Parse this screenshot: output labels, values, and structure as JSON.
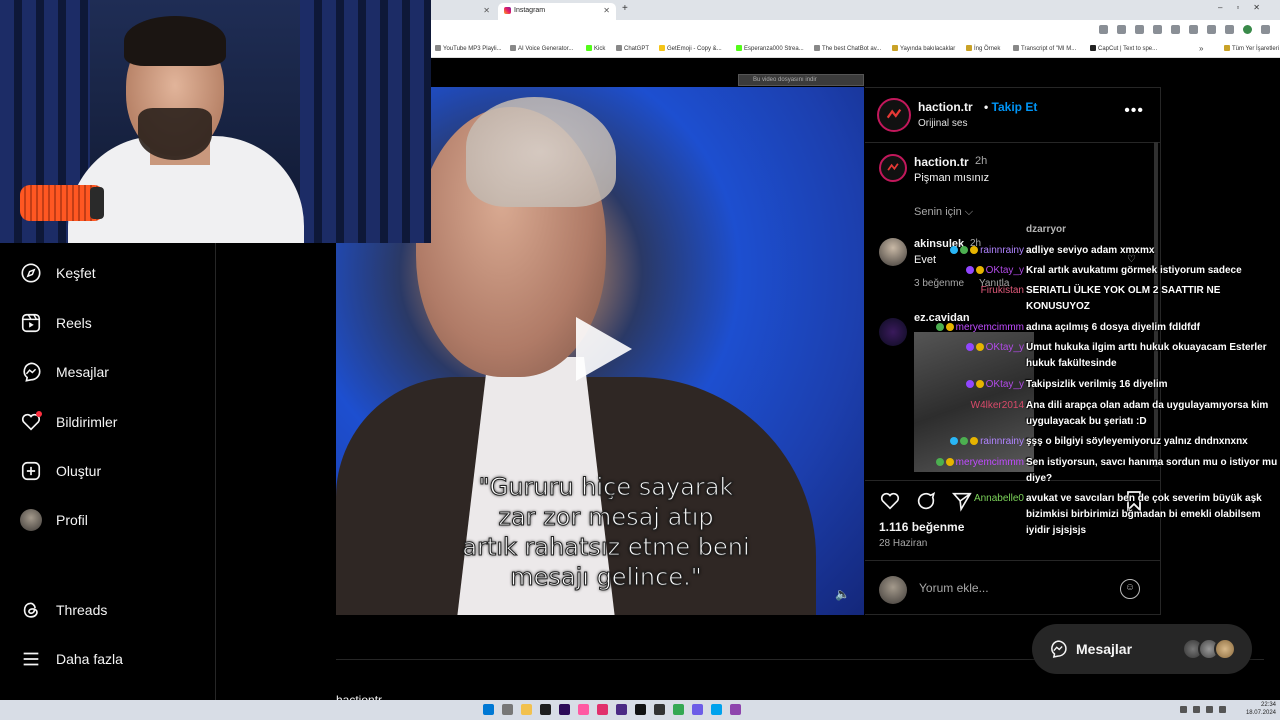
{
  "browser": {
    "tabs": [
      {
        "title": ""
      },
      {
        "title": "Instagram"
      }
    ],
    "bookmarks": [
      "YouTube MP3 Playli...",
      "AI Voice Generator...",
      "Kick",
      "ChatGPT",
      "GetEmoji - Copy &...",
      "Esperanza000 Strea...",
      "The best ChatBot av...",
      "Yayında bakılacaklar",
      "İng Örnek",
      "Transcript of \"MI M...",
      "CapCut | Text to spe..."
    ],
    "bookmarks_other": "Tüm Yer İşaretleri",
    "download_notice": "Bu video dosyasını indir"
  },
  "sidebar": {
    "items": [
      {
        "label": "Keşfet",
        "icon": "compass-icon"
      },
      {
        "label": "Reels",
        "icon": "reels-icon"
      },
      {
        "label": "Mesajlar",
        "icon": "messenger-icon"
      },
      {
        "label": "Bildirimler",
        "icon": "heart-icon"
      },
      {
        "label": "Oluştur",
        "icon": "plus-square-icon"
      },
      {
        "label": "Profil",
        "icon": "avatar"
      },
      {
        "label": "Threads",
        "icon": "threads-icon"
      },
      {
        "label": "Daha fazla",
        "icon": "menu-icon"
      }
    ]
  },
  "video": {
    "subtitle_lines": [
      "\"Gururu hiçe sayarak",
      "zar zor mesaj atıp",
      "artık rahatsız etme beni",
      "mesajı gelince.\""
    ]
  },
  "post": {
    "username": "haction.tr",
    "separator": "•",
    "follow_label": "Takip Et",
    "audio": "Orijinal ses",
    "caption_user": "haction.tr",
    "caption_time": "2h",
    "caption_text": "Pişman mısınız",
    "for_you": "Senin için",
    "comments": [
      {
        "user": "akinsulek",
        "time": "2h",
        "text": "Evet",
        "likes": "3 beğenme",
        "reply": "Yanıtla"
      },
      {
        "user": "ez.cavidan"
      }
    ],
    "likes": "1.116 beğenme",
    "date": "28 Haziran",
    "comment_placeholder": "Yorum ekle..."
  },
  "chat": [
    {
      "user": "",
      "text": "dzarryor",
      "color": "#ffffff"
    },
    {
      "user": "rainnrainy",
      "text": "adliye seviyo adam xmxmx",
      "color": "#b084ff",
      "badges": [
        "b-blue",
        "b-green",
        "b-gold"
      ]
    },
    {
      "user": "OKtay_y",
      "text": "Kral artık avukatımı görmek istiyorum sadece",
      "color": "#b04ae6",
      "badges": [
        "b-purple",
        "b-gold"
      ]
    },
    {
      "user": "Firukistan",
      "text": "SERIATLI ÜLKE YOK OLM 2 SAATTIR NE KONUSUYOZ",
      "color": "#e05a7a"
    },
    {
      "user": "meryemcimmm",
      "text": "adına açılmış 6 dosya diyelim fdldfdf",
      "color": "#c04cff",
      "badges": [
        "b-green",
        "b-gold"
      ]
    },
    {
      "user": "OKtay_y",
      "text": "Umut hukuka ilgim arttı hukuk okuayacam Esterler hukuk fakültesinde",
      "color": "#b04ae6",
      "badges": [
        "b-purple",
        "b-gold"
      ]
    },
    {
      "user": "OKtay_y",
      "text": "Takipsizlik verilmiş 16 diyelim",
      "color": "#b04ae6",
      "badges": [
        "b-purple",
        "b-gold"
      ]
    },
    {
      "user": "W4lker2014",
      "text": "Ana dili arapça olan adam da uygulayamıyorsa kim uygulayacak bu şeriatı :D",
      "color": "#d84a6a"
    },
    {
      "user": "rainnrainy",
      "text": "şşş o bilgiyi söyleyemiyoruz yalnız dndnxnxnx",
      "color": "#b084ff",
      "badges": [
        "b-blue",
        "b-green",
        "b-gold"
      ]
    },
    {
      "user": "meryemcimmm",
      "text": "Sen istiyorsun, savcı hanıma sordun mu o istiyor mu diye?",
      "color": "#c04cff",
      "badges": [
        "b-green",
        "b-gold"
      ]
    },
    {
      "user": "Annabelle0",
      "text": "avukat ve savcıları ben de çok severim büyük aşk bizimkisi birbirimizi bğmadan bi emekli olabilsem iyidir jsjsjsjs",
      "color": "#7cd35a"
    }
  ],
  "messages_fab": {
    "label": "Mesajlar"
  },
  "below_text": "hactiontr",
  "taskbar": {
    "time": "22:34",
    "date": "18.07.2024"
  },
  "colors": {
    "accent": "#0095f6",
    "notification": "#ff3040",
    "background": "#000000"
  }
}
